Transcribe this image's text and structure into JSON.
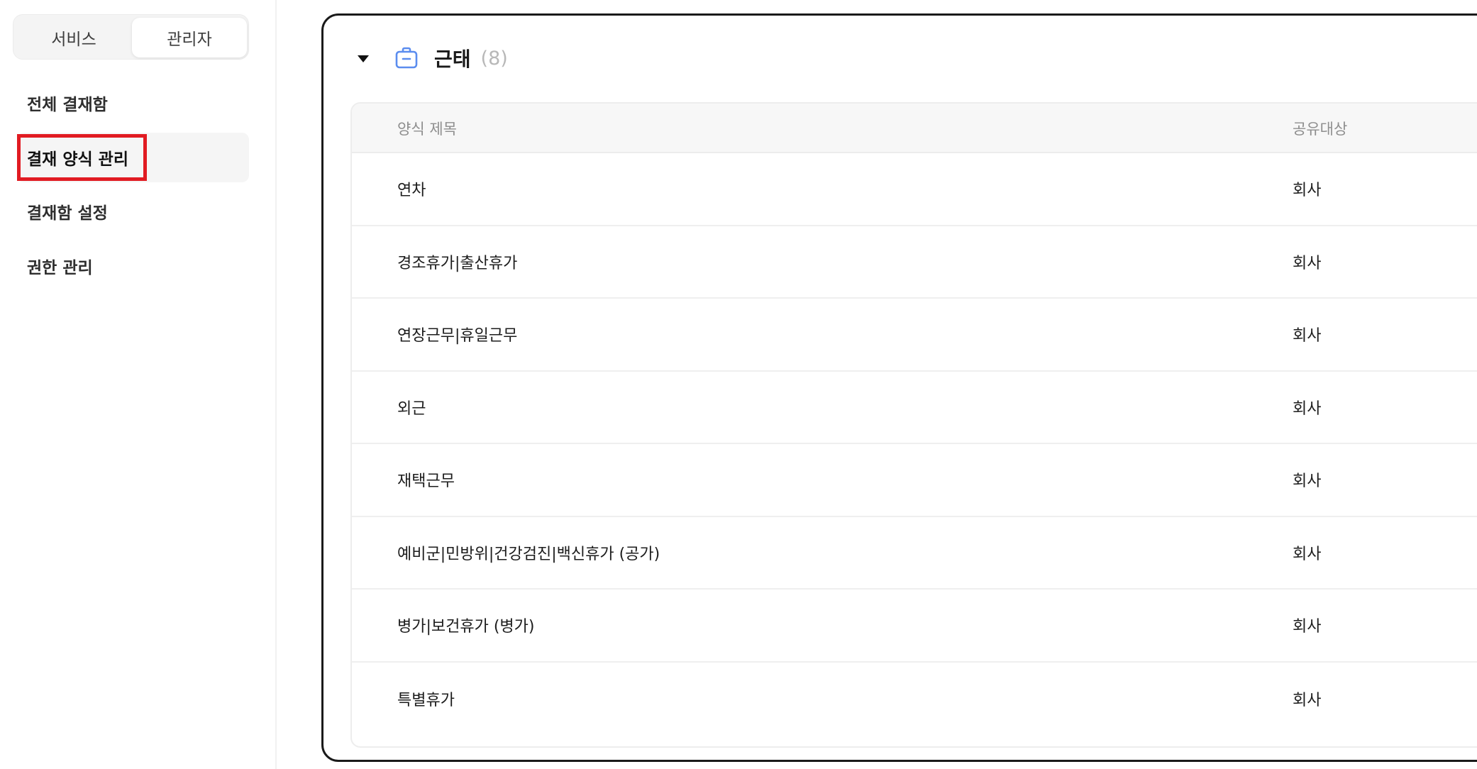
{
  "sidebar": {
    "mode_toggle": {
      "service_label": "서비스",
      "admin_label": "관리자"
    },
    "items": [
      {
        "label": "전체 결재함"
      },
      {
        "label": "결재 양식 관리"
      },
      {
        "label": "결재함 설정"
      },
      {
        "label": "권한 관리"
      }
    ],
    "highlight_color": "#e11b22"
  },
  "group": {
    "title": "근태",
    "count": "(8)",
    "icon": "briefcase-icon",
    "icon_color": "#5b8def",
    "columns": {
      "title": "양식 제목",
      "share": "공유대상"
    },
    "rows": [
      {
        "title": "연차",
        "share": "회사"
      },
      {
        "title": "경조휴가|출산휴가",
        "share": "회사"
      },
      {
        "title": "연장근무|휴일근무",
        "share": "회사"
      },
      {
        "title": "외근",
        "share": "회사"
      },
      {
        "title": "재택근무",
        "share": "회사"
      },
      {
        "title": "예비군|민방위|건강검진|백신휴가 (공가)",
        "share": "회사"
      },
      {
        "title": "병가|보건휴가 (병가)",
        "share": "회사"
      },
      {
        "title": "특별휴가",
        "share": "회사"
      }
    ]
  }
}
